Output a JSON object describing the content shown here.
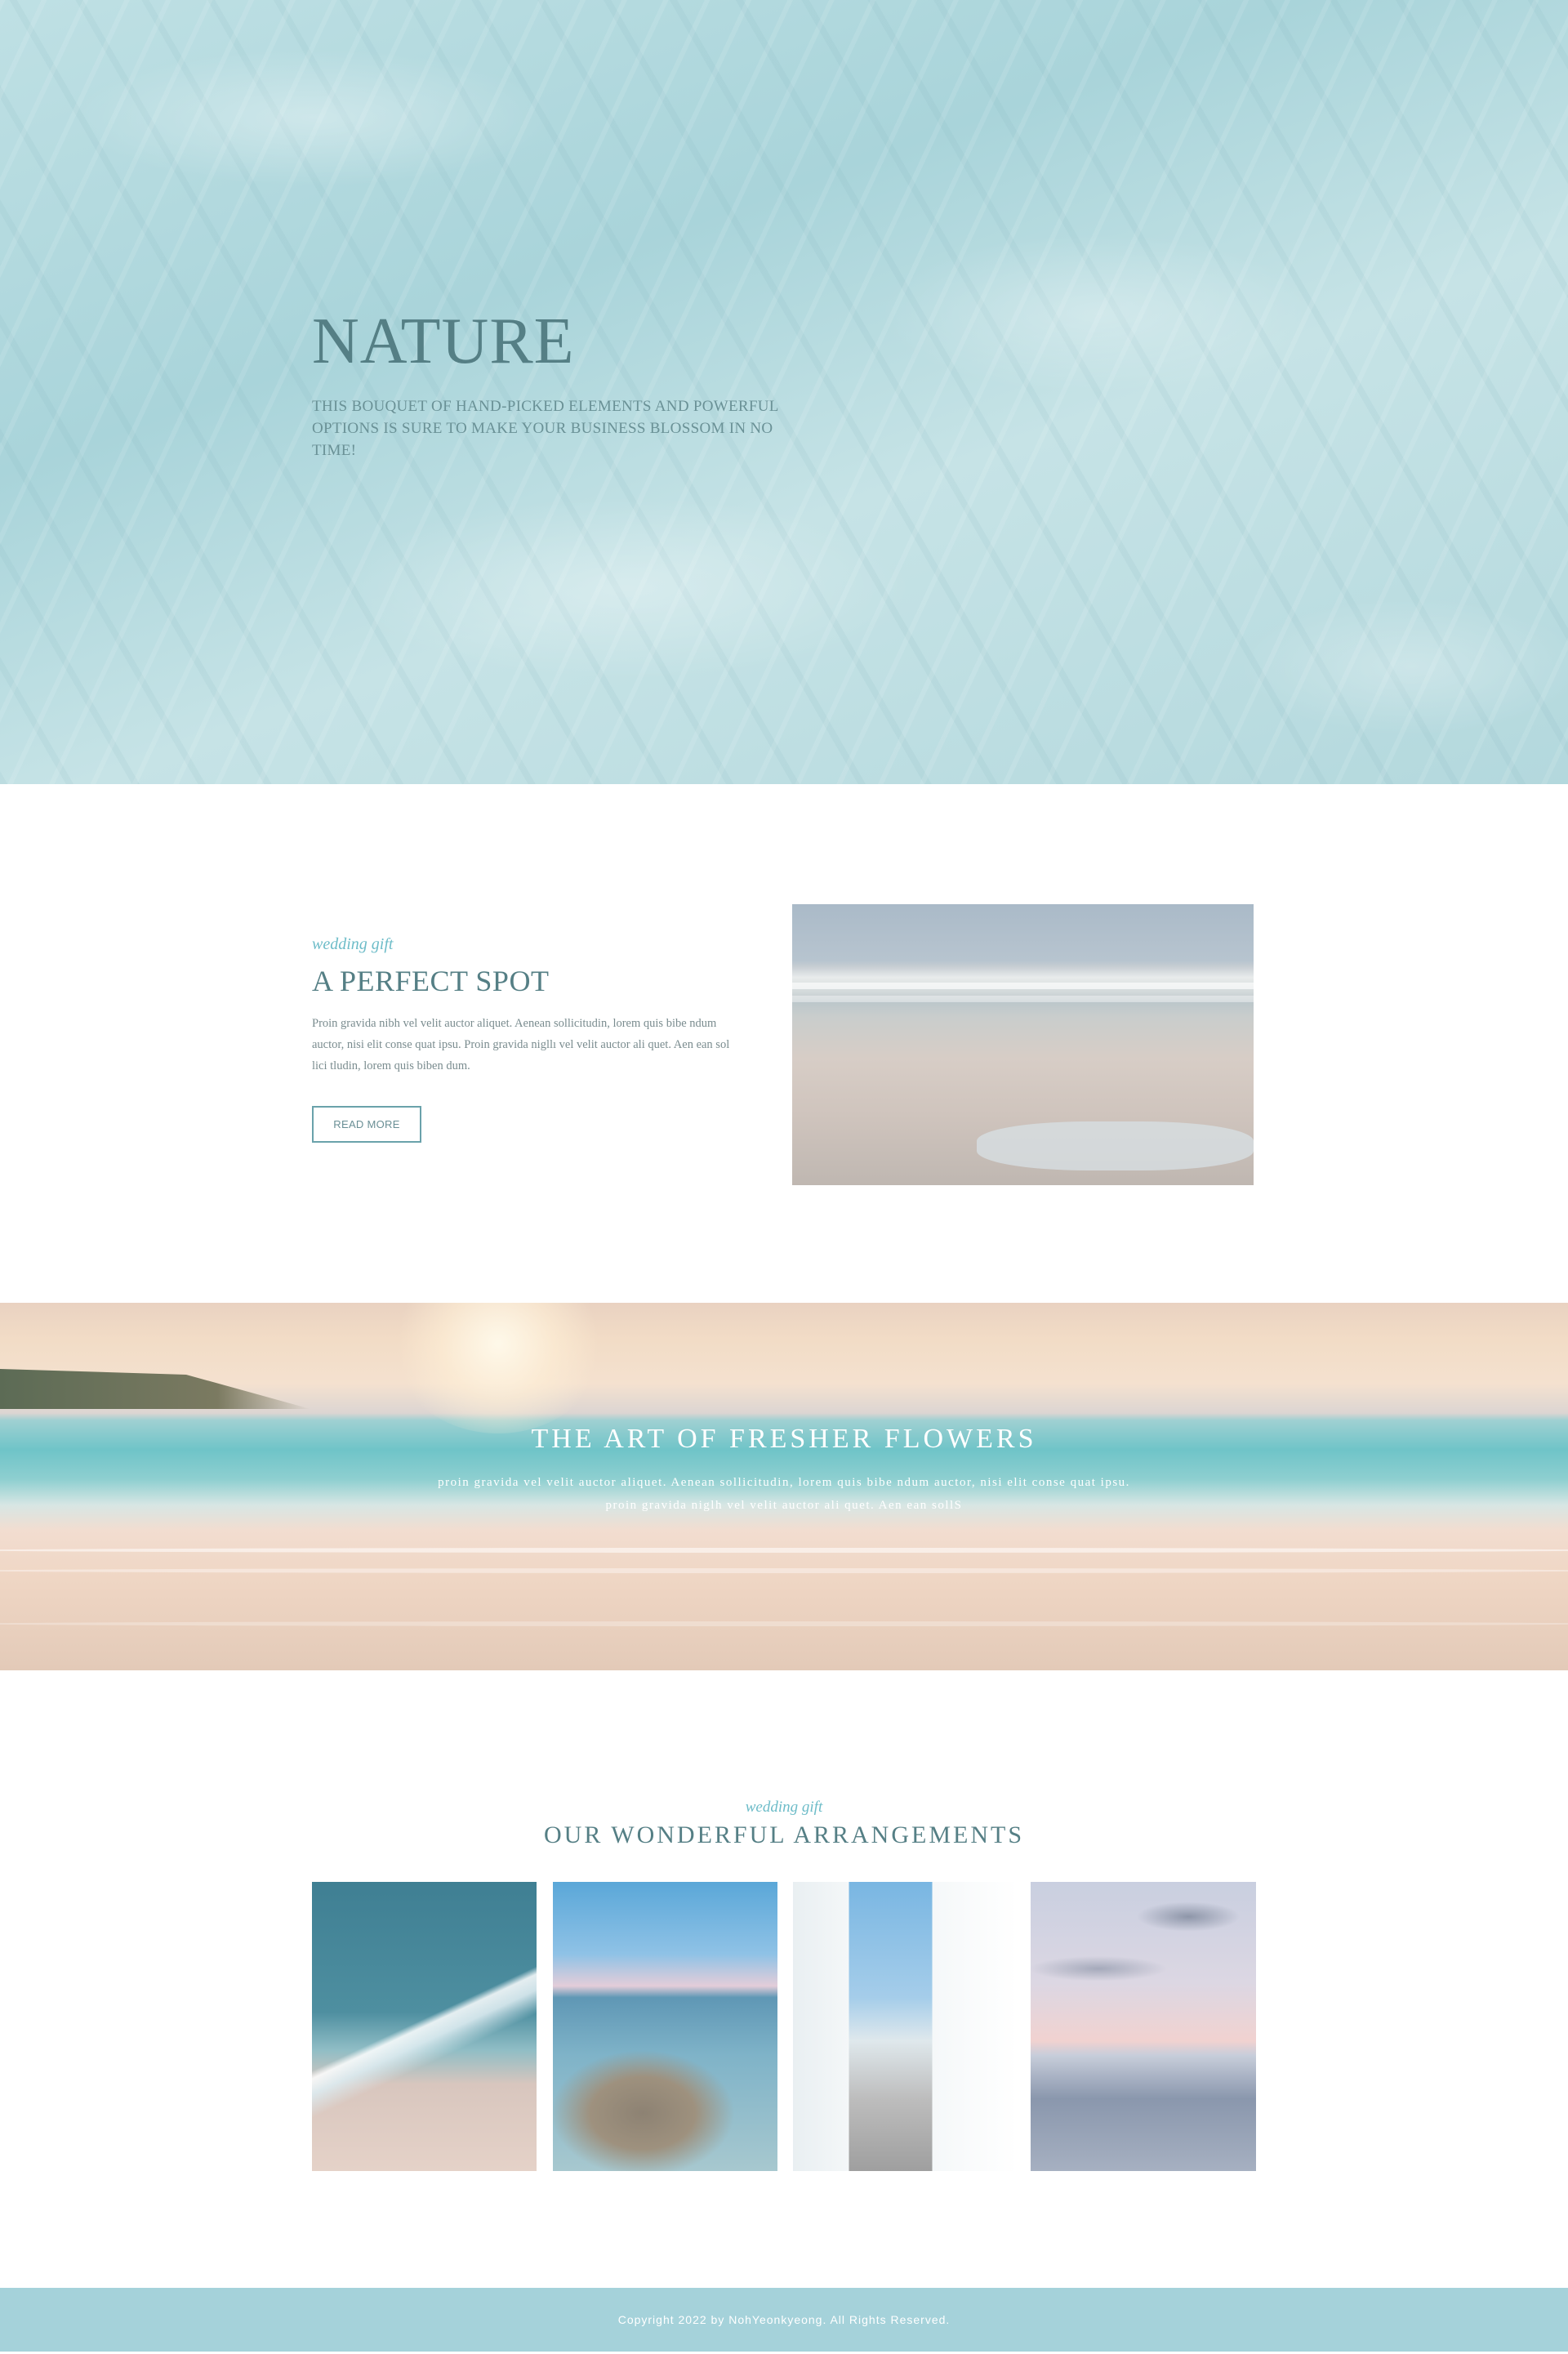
{
  "hero": {
    "title": "NATURE",
    "text": "THIS BOUQUET OF HAND-PICKED ELEMENTS AND POWERFUL OPTIONS IS SURE TO MAKE YOUR BUSINESS BLOSSOM IN NO TIME!"
  },
  "spot": {
    "eyebrow": "wedding gift",
    "title": "A PERFECT SPOT",
    "body": "Proin gravida nibh vel velit auctor aliquet. Aenean sollicitudin, lorem quis bibe ndum auctor, nisi elit conse quat ipsu. Proin gravida nigllı vel velit auctor ali quet. Aen ean sol lici tludin, lorem quis biben dum.",
    "button_label": "READ MORE"
  },
  "banner": {
    "title": "THE ART OF FRESHER FLOWERS",
    "text": "proin gravida vel velit auctor aliquet. Aenean sollicitudin, lorem quis bibe ndum auctor, nisi elit conse quat ipsu. proin gravida niglh vel velit auctor ali quet. Aen ean sollS"
  },
  "arrangements": {
    "eyebrow": "wedding gift",
    "title": "OUR WONDERFUL ARRANGEMENTS",
    "tiles": [
      "aerial-waves-photo",
      "rocky-shore-photo",
      "white-alley-photo",
      "cloudy-sea-photo"
    ]
  },
  "footer": {
    "copyright": "Copyright 2022 by NohYeonkyeong. All Rights Reserved."
  },
  "colors": {
    "accent": "#6dbcc8",
    "heading": "#557f85",
    "footer_bg": "#a5d2da"
  }
}
